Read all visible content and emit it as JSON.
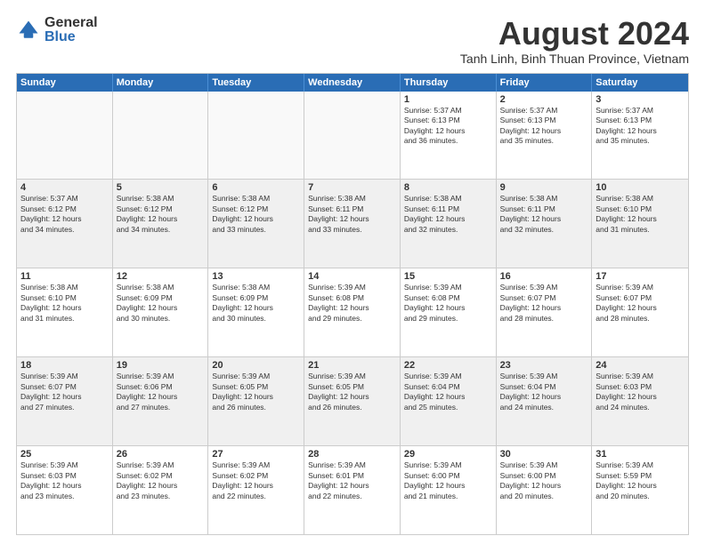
{
  "logo": {
    "general": "General",
    "blue": "Blue"
  },
  "header": {
    "title": "August 2024",
    "subtitle": "Tanh Linh, Binh Thuan Province, Vietnam"
  },
  "weekdays": [
    "Sunday",
    "Monday",
    "Tuesday",
    "Wednesday",
    "Thursday",
    "Friday",
    "Saturday"
  ],
  "rows": [
    [
      {
        "day": "",
        "info": "",
        "empty": true
      },
      {
        "day": "",
        "info": "",
        "empty": true
      },
      {
        "day": "",
        "info": "",
        "empty": true
      },
      {
        "day": "",
        "info": "",
        "empty": true
      },
      {
        "day": "1",
        "info": "Sunrise: 5:37 AM\nSunset: 6:13 PM\nDaylight: 12 hours\nand 36 minutes."
      },
      {
        "day": "2",
        "info": "Sunrise: 5:37 AM\nSunset: 6:13 PM\nDaylight: 12 hours\nand 35 minutes."
      },
      {
        "day": "3",
        "info": "Sunrise: 5:37 AM\nSunset: 6:13 PM\nDaylight: 12 hours\nand 35 minutes."
      }
    ],
    [
      {
        "day": "4",
        "info": "Sunrise: 5:37 AM\nSunset: 6:12 PM\nDaylight: 12 hours\nand 34 minutes."
      },
      {
        "day": "5",
        "info": "Sunrise: 5:38 AM\nSunset: 6:12 PM\nDaylight: 12 hours\nand 34 minutes."
      },
      {
        "day": "6",
        "info": "Sunrise: 5:38 AM\nSunset: 6:12 PM\nDaylight: 12 hours\nand 33 minutes."
      },
      {
        "day": "7",
        "info": "Sunrise: 5:38 AM\nSunset: 6:11 PM\nDaylight: 12 hours\nand 33 minutes."
      },
      {
        "day": "8",
        "info": "Sunrise: 5:38 AM\nSunset: 6:11 PM\nDaylight: 12 hours\nand 32 minutes."
      },
      {
        "day": "9",
        "info": "Sunrise: 5:38 AM\nSunset: 6:11 PM\nDaylight: 12 hours\nand 32 minutes."
      },
      {
        "day": "10",
        "info": "Sunrise: 5:38 AM\nSunset: 6:10 PM\nDaylight: 12 hours\nand 31 minutes."
      }
    ],
    [
      {
        "day": "11",
        "info": "Sunrise: 5:38 AM\nSunset: 6:10 PM\nDaylight: 12 hours\nand 31 minutes."
      },
      {
        "day": "12",
        "info": "Sunrise: 5:38 AM\nSunset: 6:09 PM\nDaylight: 12 hours\nand 30 minutes."
      },
      {
        "day": "13",
        "info": "Sunrise: 5:38 AM\nSunset: 6:09 PM\nDaylight: 12 hours\nand 30 minutes."
      },
      {
        "day": "14",
        "info": "Sunrise: 5:39 AM\nSunset: 6:08 PM\nDaylight: 12 hours\nand 29 minutes."
      },
      {
        "day": "15",
        "info": "Sunrise: 5:39 AM\nSunset: 6:08 PM\nDaylight: 12 hours\nand 29 minutes."
      },
      {
        "day": "16",
        "info": "Sunrise: 5:39 AM\nSunset: 6:07 PM\nDaylight: 12 hours\nand 28 minutes."
      },
      {
        "day": "17",
        "info": "Sunrise: 5:39 AM\nSunset: 6:07 PM\nDaylight: 12 hours\nand 28 minutes."
      }
    ],
    [
      {
        "day": "18",
        "info": "Sunrise: 5:39 AM\nSunset: 6:07 PM\nDaylight: 12 hours\nand 27 minutes."
      },
      {
        "day": "19",
        "info": "Sunrise: 5:39 AM\nSunset: 6:06 PM\nDaylight: 12 hours\nand 27 minutes."
      },
      {
        "day": "20",
        "info": "Sunrise: 5:39 AM\nSunset: 6:05 PM\nDaylight: 12 hours\nand 26 minutes."
      },
      {
        "day": "21",
        "info": "Sunrise: 5:39 AM\nSunset: 6:05 PM\nDaylight: 12 hours\nand 26 minutes."
      },
      {
        "day": "22",
        "info": "Sunrise: 5:39 AM\nSunset: 6:04 PM\nDaylight: 12 hours\nand 25 minutes."
      },
      {
        "day": "23",
        "info": "Sunrise: 5:39 AM\nSunset: 6:04 PM\nDaylight: 12 hours\nand 24 minutes."
      },
      {
        "day": "24",
        "info": "Sunrise: 5:39 AM\nSunset: 6:03 PM\nDaylight: 12 hours\nand 24 minutes."
      }
    ],
    [
      {
        "day": "25",
        "info": "Sunrise: 5:39 AM\nSunset: 6:03 PM\nDaylight: 12 hours\nand 23 minutes."
      },
      {
        "day": "26",
        "info": "Sunrise: 5:39 AM\nSunset: 6:02 PM\nDaylight: 12 hours\nand 23 minutes."
      },
      {
        "day": "27",
        "info": "Sunrise: 5:39 AM\nSunset: 6:02 PM\nDaylight: 12 hours\nand 22 minutes."
      },
      {
        "day": "28",
        "info": "Sunrise: 5:39 AM\nSunset: 6:01 PM\nDaylight: 12 hours\nand 22 minutes."
      },
      {
        "day": "29",
        "info": "Sunrise: 5:39 AM\nSunset: 6:00 PM\nDaylight: 12 hours\nand 21 minutes."
      },
      {
        "day": "30",
        "info": "Sunrise: 5:39 AM\nSunset: 6:00 PM\nDaylight: 12 hours\nand 20 minutes."
      },
      {
        "day": "31",
        "info": "Sunrise: 5:39 AM\nSunset: 5:59 PM\nDaylight: 12 hours\nand 20 minutes."
      }
    ]
  ]
}
